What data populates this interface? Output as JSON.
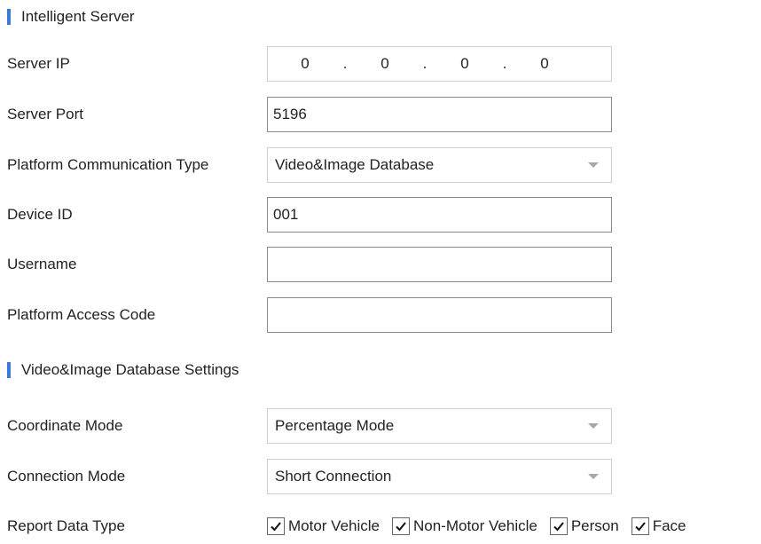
{
  "sections": {
    "intelligent_server": "Intelligent Server",
    "database_settings": "Video&Image Database Settings"
  },
  "server_ip": {
    "label": "Server IP",
    "octets": [
      "0",
      "0",
      "0",
      "0"
    ],
    "separator": "."
  },
  "server_port": {
    "label": "Server Port",
    "value": "5196"
  },
  "communication_type": {
    "label": "Platform Communication Type",
    "value": "Video&Image Database"
  },
  "device_id": {
    "label": "Device ID",
    "value": "001"
  },
  "username": {
    "label": "Username",
    "value": ""
  },
  "access_code": {
    "label": "Platform Access Code",
    "value": ""
  },
  "coordinate_mode": {
    "label": "Coordinate Mode",
    "value": "Percentage Mode"
  },
  "connection_mode": {
    "label": "Connection Mode",
    "value": "Short Connection"
  },
  "report_data_type": {
    "label": "Report Data Type",
    "options": [
      {
        "label": "Motor Vehicle",
        "checked": true
      },
      {
        "label": "Non-Motor Vehicle",
        "checked": true
      },
      {
        "label": "Person",
        "checked": true
      },
      {
        "label": "Face",
        "checked": true
      }
    ]
  },
  "colors": {
    "accent": "#3a7bd5",
    "border": "#8a8a8a",
    "text": "#222222"
  }
}
